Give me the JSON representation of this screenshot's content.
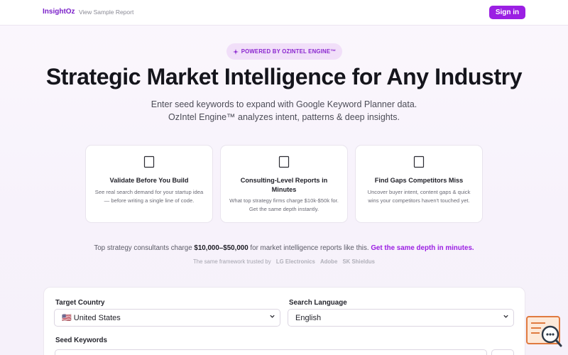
{
  "header": {
    "brand": "InsightOz",
    "sample_link": "View Sample Report",
    "signin_label": "Sign in"
  },
  "hero": {
    "badge_icon": "sparkle-icon",
    "badge_text": "POWERED BY OZINTEL ENGINE™",
    "title": "Strategic Market Intelligence for Any Industry",
    "subtitle": "Enter seed keywords to expand with Google Keyword Planner data. OzIntel Engine™ analyzes intent, patterns & deep insights."
  },
  "features": [
    {
      "icon": "target-icon",
      "title": "Validate Before You Build",
      "description": "See real search demand for your startup idea — before writing a single line of code."
    },
    {
      "icon": "report-icon",
      "title": "Consulting-Level Reports in Minutes",
      "description": "What top strategy firms charge $10k-$50k for. Get the same depth instantly."
    },
    {
      "icon": "magnifier-icon",
      "title": "Find Gaps Competitors Miss",
      "description": "Uncover buyer intent, content gaps & quick wins your competitors haven't touched yet."
    }
  ],
  "pricing": {
    "prefix": "Top strategy consultants charge",
    "amount": "$10,000–$50,000",
    "middle": "for market intelligence reports like this.",
    "highlight": "Get the same depth in minutes."
  },
  "trusted": {
    "label": "The same framework trusted by",
    "companies": [
      "LG Electronics",
      "Adobe",
      "SK Shieldus"
    ]
  },
  "form": {
    "country_label": "Target Country",
    "country_value": "🇺🇸 United States",
    "language_label": "Search Language",
    "language_value": "English",
    "keywords_label": "Seed Keywords"
  },
  "colors": {
    "accent": "#9b1fe3",
    "brand": "#7a1fc9",
    "badge_bg": "#f1dff9"
  }
}
